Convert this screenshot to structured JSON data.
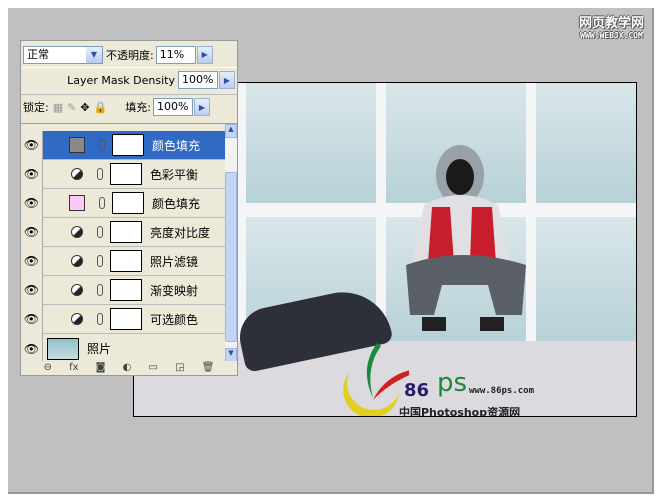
{
  "watermark": {
    "title": "网页教学网",
    "url": "WWW.WEBJX.COM"
  },
  "panel": {
    "blend_mode": "正常",
    "opacity_label": "不透明度:",
    "opacity": "11%",
    "mask_density_label": "Layer Mask Density",
    "mask_density": "100%",
    "lock_label": "锁定:",
    "fill_label": "填充:",
    "fill": "100%",
    "layers": [
      {
        "name": "颜色填充",
        "type": "fill",
        "color": "#888888",
        "selected": true
      },
      {
        "name": "色彩平衡",
        "type": "adjust"
      },
      {
        "name": "颜色填充",
        "type": "fill",
        "color": "#f9c8f4"
      },
      {
        "name": "亮度对比度",
        "type": "adjust"
      },
      {
        "name": "照片滤镜",
        "type": "adjust"
      },
      {
        "name": "渐变映射",
        "type": "adjust"
      },
      {
        "name": "可选颜色",
        "type": "adjust"
      }
    ],
    "base_layer": "照片",
    "tools": [
      "link-icon",
      "fx-icon",
      "mask-icon",
      "adjustment-icon",
      "folder-icon",
      "new-layer-icon",
      "trash-icon"
    ],
    "tool_glyphs": [
      "⊖",
      "fx",
      "◙",
      "◐",
      "▭",
      "◲",
      "🗑"
    ]
  },
  "logo": {
    "num": "86",
    "ps": "ps",
    "url": "www.86ps.com",
    "cn": "中国Photoshop资源网"
  }
}
